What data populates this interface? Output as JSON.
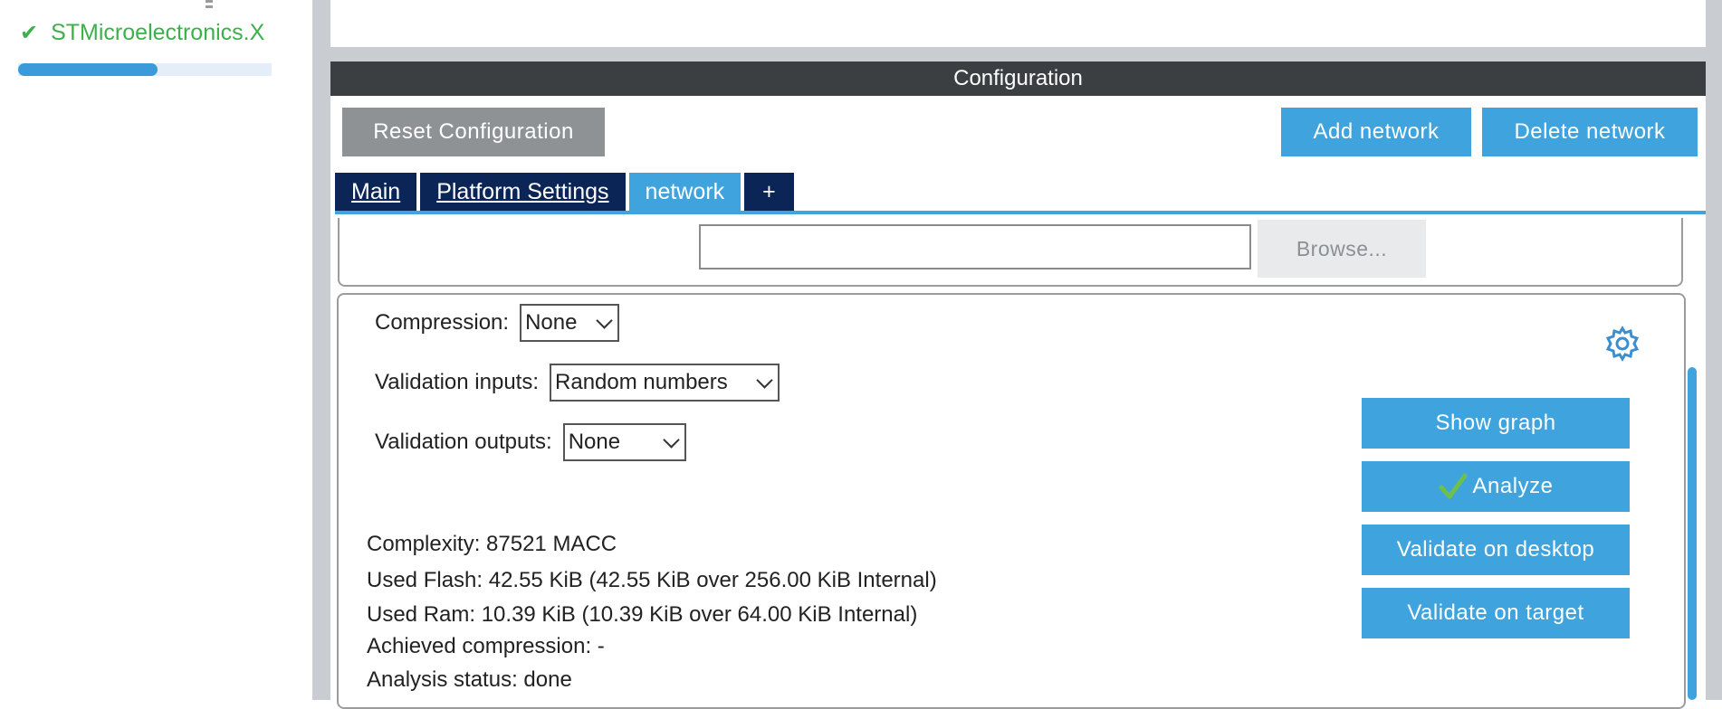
{
  "tree": {
    "item_label": "STMicroelectronics.X",
    "progress": 0.55
  },
  "config": {
    "title": "Configuration",
    "reset_label": "Reset Configuration",
    "add_network_label": "Add network",
    "delete_network_label": "Delete network",
    "tabs": [
      {
        "label": "Main",
        "active": false
      },
      {
        "label": "Platform Settings",
        "active": false
      },
      {
        "label": "network",
        "active": true
      },
      {
        "label": "+",
        "active": false
      }
    ],
    "model_path": "",
    "browse_label": "Browse..."
  },
  "settings": {
    "compression": {
      "label": "Compression:",
      "value": "None"
    },
    "validation_inputs": {
      "label": "Validation inputs:",
      "value": "Random numbers"
    },
    "validation_outputs": {
      "label": "Validation outputs:",
      "value": "None"
    },
    "complexity": "Complexity:  87521 MACC",
    "used_flash": "Used Flash: 42.55 KiB (42.55 KiB over 256.00 KiB Internal)",
    "used_ram": "Used Ram: 10.39 KiB (10.39 KiB over 64.00 KiB Internal)",
    "achieved_compression": "Achieved compression: -",
    "analysis_status": "Analysis status: done",
    "actions": {
      "show_graph": "Show graph",
      "analyze": "Analyze",
      "validate_desktop": "Validate on desktop",
      "validate_target": "Validate on target"
    }
  },
  "colors": {
    "accent": "#3fa4dd",
    "tab_dark": "#0b2656",
    "success": "#3db04b"
  }
}
